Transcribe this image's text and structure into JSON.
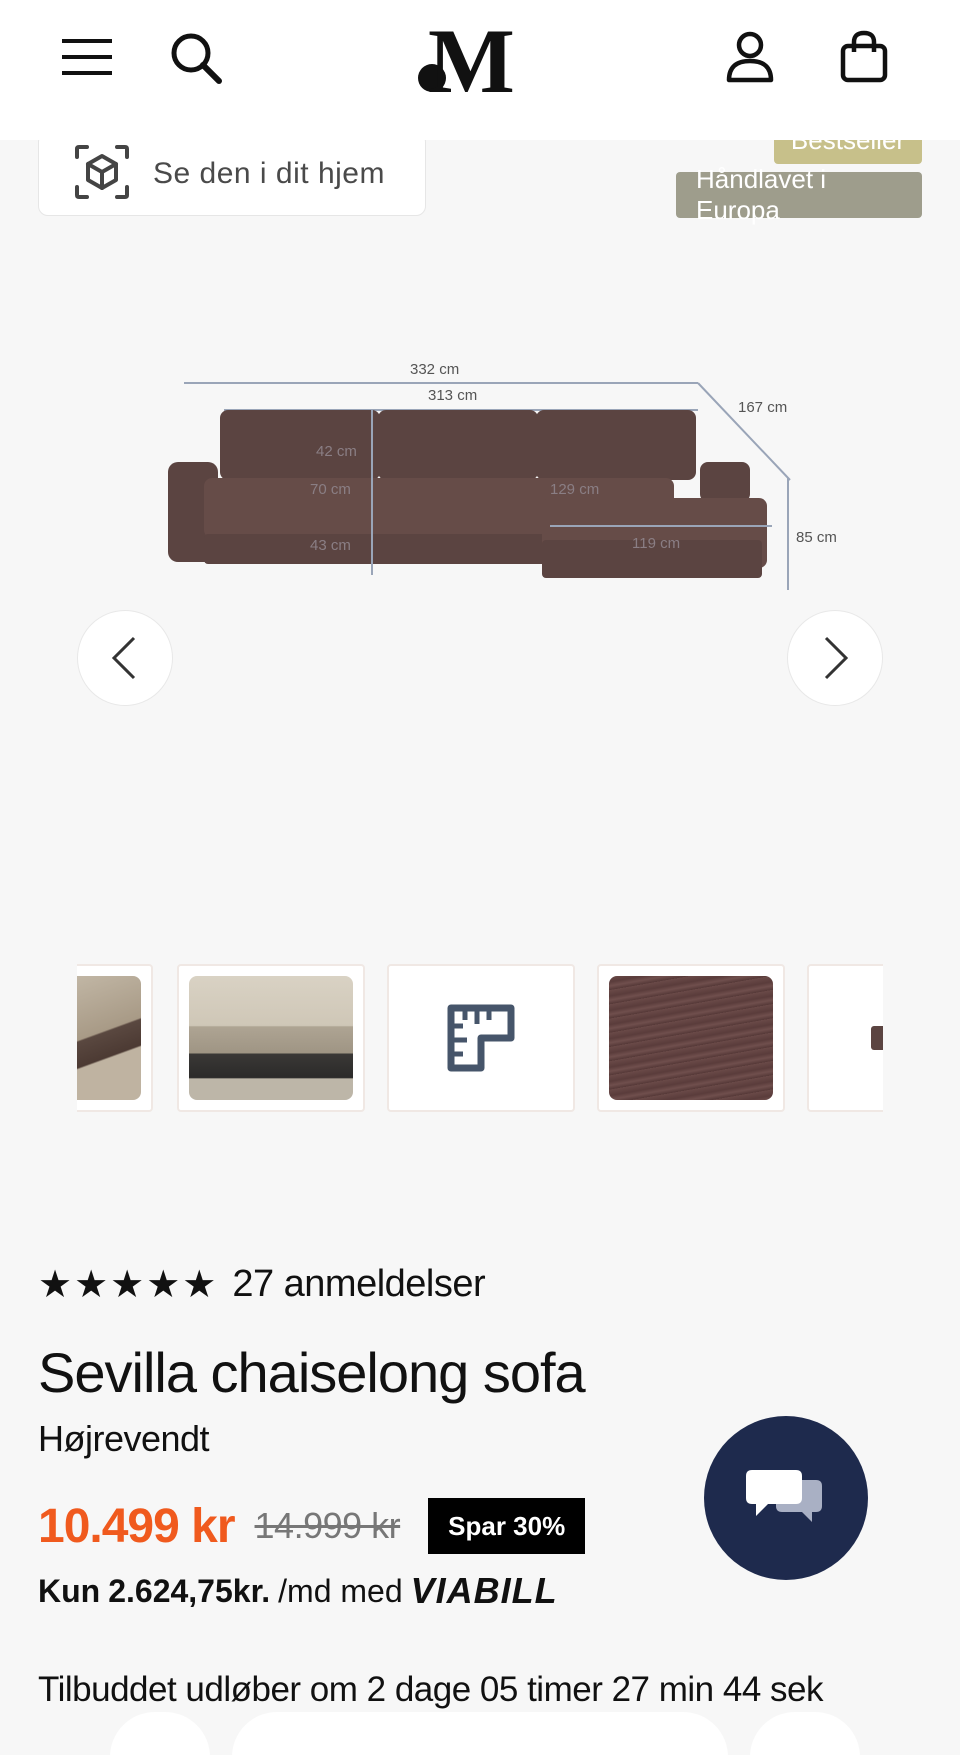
{
  "header": {
    "logo_text": "M"
  },
  "ar_button": {
    "label": "Se den i dit hjem"
  },
  "badges": {
    "bestseller": "Bestseller",
    "handmade": "Håndlavet i Europa"
  },
  "hero": {
    "dimensions": {
      "total_width": "332 cm",
      "inner_width": "313 cm",
      "depth": "167 cm",
      "back_height": "42 cm",
      "seat_depth": "70 cm",
      "seat_height": "43 cm",
      "chaise_length": "129 cm",
      "chaise_width": "119 cm",
      "height": "85 cm"
    },
    "sofa_color": "#5b4441"
  },
  "thumbnails": [
    {
      "name": "thumb-lifestyle-partial"
    },
    {
      "name": "thumb-living-room"
    },
    {
      "name": "thumb-dimensions-icon"
    },
    {
      "name": "thumb-fabric"
    },
    {
      "name": "thumb-sofa-partial"
    }
  ],
  "product": {
    "stars": "★★★★★",
    "reviews": "27 anmeldelser",
    "title": "Sevilla chaiselong sofa",
    "variant": "Højrevendt",
    "price": "10.499 kr",
    "old_price": "14.999 kr",
    "save": "Spar 30%",
    "finance_prefix": "Kun",
    "finance_amount": "2.624,75kr.",
    "finance_suffix": "/md med",
    "finance_brand": "VIABILL",
    "offer": "Tilbuddet udløber om 2 dage 05 timer 27 min 44 sek"
  },
  "colors": {
    "price": "#f05a1e",
    "chat": "#1e2a4d",
    "badge_bestseller": "#c7c08a",
    "badge_handmade": "#9e9d8c"
  }
}
